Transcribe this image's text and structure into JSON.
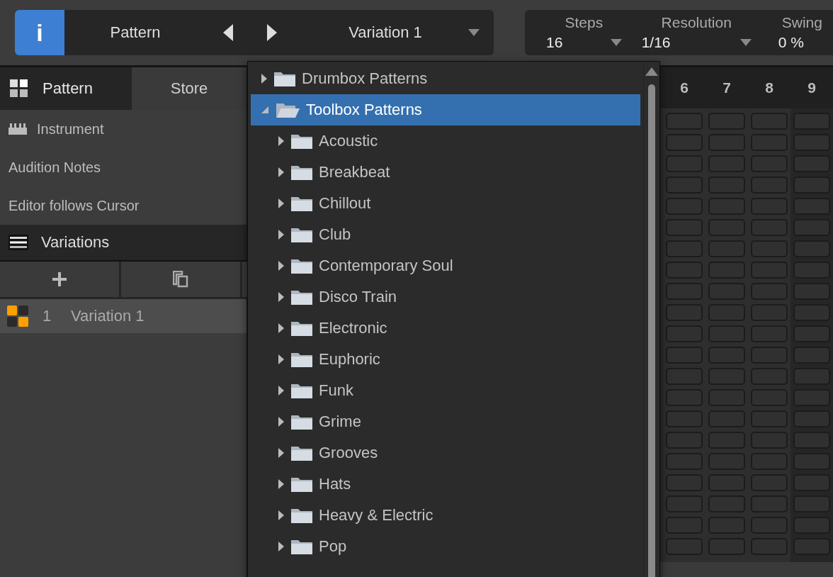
{
  "toolbar": {
    "info_button": "i",
    "pattern_label": "Pattern",
    "variation_select": "Variation 1"
  },
  "settings": [
    {
      "label": "Steps",
      "value": "16",
      "kind": "dropdown"
    },
    {
      "label": "Resolution",
      "value": "1/16",
      "kind": "dropdown"
    },
    {
      "label": "Swing",
      "value": "0 %",
      "kind": "plain"
    }
  ],
  "left_tabs": [
    {
      "label": "Pattern",
      "selected": true
    },
    {
      "label": "Store",
      "selected": false
    }
  ],
  "options": [
    {
      "label": "Instrument",
      "kind": "instrument"
    },
    {
      "label": "Audition Notes",
      "kind": "plain"
    },
    {
      "label": "Editor follows Cursor",
      "kind": "plain"
    }
  ],
  "variations": {
    "title": "Variations",
    "items": [
      {
        "number": "1",
        "name": "Variation 1",
        "selected": true
      }
    ]
  },
  "grid": {
    "columns": [
      "6",
      "7",
      "8",
      "9"
    ]
  },
  "browser": {
    "items": [
      {
        "label": "Drumbox Patterns",
        "expanded": false,
        "selected": false
      },
      {
        "label": "Toolbox Patterns",
        "expanded": true,
        "selected": true,
        "children": [
          {
            "label": "Acoustic",
            "expanded": false,
            "selected": false
          },
          {
            "label": "Breakbeat",
            "expanded": false,
            "selected": false
          },
          {
            "label": "Chillout",
            "expanded": false,
            "selected": false
          },
          {
            "label": "Club",
            "expanded": false,
            "selected": false
          },
          {
            "label": "Contemporary Soul",
            "expanded": false,
            "selected": false
          },
          {
            "label": "Disco Train",
            "expanded": false,
            "selected": false
          },
          {
            "label": "Electronic",
            "expanded": false,
            "selected": false
          },
          {
            "label": "Euphoric",
            "expanded": false,
            "selected": false
          },
          {
            "label": "Funk",
            "expanded": false,
            "selected": false
          },
          {
            "label": "Grime",
            "expanded": false,
            "selected": false
          },
          {
            "label": "Grooves",
            "expanded": false,
            "selected": false
          },
          {
            "label": "Hats",
            "expanded": false,
            "selected": false
          },
          {
            "label": "Heavy & Electric",
            "expanded": false,
            "selected": false
          },
          {
            "label": "Pop",
            "expanded": false,
            "selected": false
          }
        ]
      }
    ]
  }
}
